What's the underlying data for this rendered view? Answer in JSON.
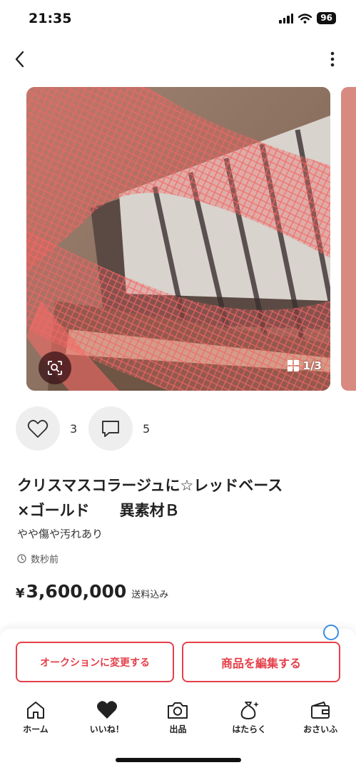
{
  "status_bar": {
    "time": "21:35",
    "battery": "96"
  },
  "carousel": {
    "page_indicator": "1/3"
  },
  "reactions": {
    "likes_count": "3",
    "comments_count": "5"
  },
  "item": {
    "title": "クリスマスコラージュに☆レッドベース\n×ゴールド　　異素材Ｂ",
    "condition": "やや傷や汚れあり",
    "posted": "数秒前",
    "price_currency": "¥",
    "price_amount": "3,600,000",
    "shipping": "送料込み"
  },
  "actions": {
    "auction_label": "オークションに変更する",
    "edit_label": "商品を編集する"
  },
  "tab_bar": {
    "items": [
      {
        "label": "ホーム",
        "icon": "home-icon"
      },
      {
        "label": "いいね！",
        "icon": "heart-icon"
      },
      {
        "label": "出品",
        "icon": "camera-icon"
      },
      {
        "label": "はたらく",
        "icon": "money-bag-icon"
      },
      {
        "label": "おさいふ",
        "icon": "wallet-icon"
      }
    ]
  },
  "colors": {
    "accent": "#e5404a",
    "info": "#3a8ee6"
  }
}
